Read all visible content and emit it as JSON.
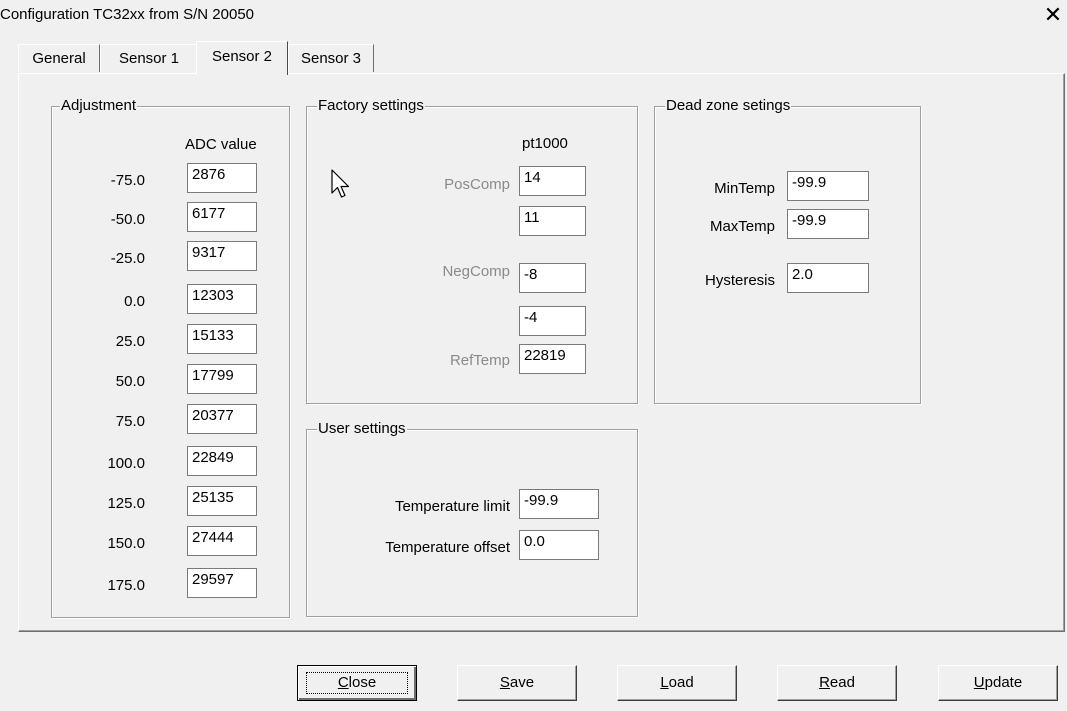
{
  "window": {
    "title": "Configuration TC32xx from S/N 20050",
    "close_glyph": "✕"
  },
  "tabs": [
    {
      "label": "General",
      "active": false
    },
    {
      "label": "Sensor 1",
      "active": false
    },
    {
      "label": "Sensor 2",
      "active": true
    },
    {
      "label": "Sensor 3",
      "active": false
    }
  ],
  "adjustment": {
    "title": "Adjustment",
    "column_header": "ADC value",
    "rows": [
      {
        "temp": "-75.0",
        "adc": "2876"
      },
      {
        "temp": "-50.0",
        "adc": "6177"
      },
      {
        "temp": "-25.0",
        "adc": "9317"
      },
      {
        "temp": "0.0",
        "adc": "12303"
      },
      {
        "temp": "25.0",
        "adc": "15133"
      },
      {
        "temp": "50.0",
        "adc": "17799"
      },
      {
        "temp": "75.0",
        "adc": "20377"
      },
      {
        "temp": "100.0",
        "adc": "22849"
      },
      {
        "temp": "125.0",
        "adc": "25135"
      },
      {
        "temp": "150.0",
        "adc": "27444"
      },
      {
        "temp": "175.0",
        "adc": "29597"
      }
    ]
  },
  "factory": {
    "title": "Factory settings",
    "sensor_type": "pt1000",
    "poscomp_label": "PosComp",
    "poscomp_1": "14",
    "poscomp_2": "11",
    "negcomp_label": "NegComp",
    "negcomp_1": "-8",
    "negcomp_2": "-4",
    "reftemp_label": "RefTemp",
    "reftemp": "22819"
  },
  "deadzone": {
    "title": "Dead zone setings",
    "mintemp_label": "MinTemp",
    "mintemp": "-99.9",
    "maxtemp_label": "MaxTemp",
    "maxtemp": "-99.9",
    "hysteresis_label": "Hysteresis",
    "hysteresis": "2.0"
  },
  "user": {
    "title": "User settings",
    "templimit_label": "Temperature limit",
    "templimit": "-99.9",
    "tempoffset_label": "Temperature offset",
    "tempoffset": "0.0"
  },
  "buttons": {
    "close": {
      "first": "C",
      "rest": "lose"
    },
    "save": {
      "first": "S",
      "rest": "ave"
    },
    "load": {
      "first": "L",
      "rest": "oad"
    },
    "read": {
      "first": "R",
      "rest": "ead"
    },
    "update": {
      "first": "U",
      "rest": "pdate"
    }
  }
}
